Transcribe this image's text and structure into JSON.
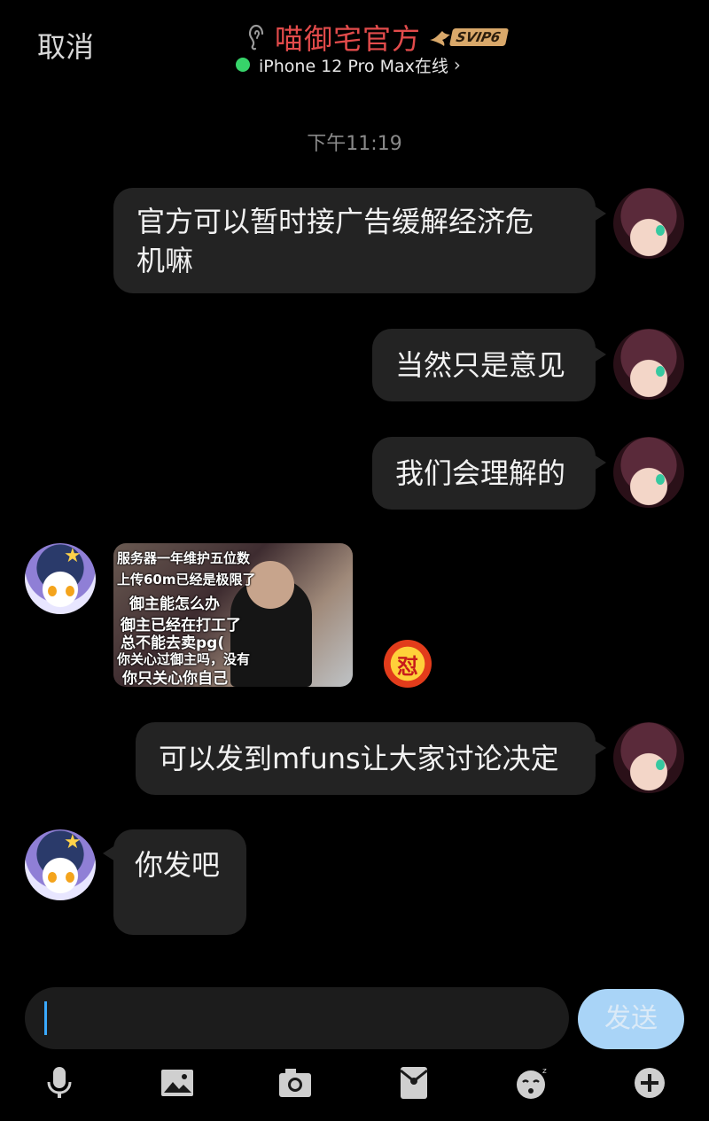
{
  "header": {
    "cancel_label": "取消",
    "title": "喵御宅官方",
    "vip_badge": "SVIP6",
    "status_text": "iPhone 12 Pro Max在线",
    "status_chevron": "›"
  },
  "timestamp": "下午11:19",
  "messages": [
    {
      "side": "right",
      "type": "text",
      "lines": [
        "官方可以暂时接广告缓解经济危",
        "机嘛"
      ]
    },
    {
      "side": "right",
      "type": "text",
      "lines": [
        "当然只是意见"
      ]
    },
    {
      "side": "right",
      "type": "text",
      "lines": [
        "我们会理解的"
      ]
    },
    {
      "side": "left",
      "type": "image",
      "caption_lines": [
        "服务器一年维护五位数",
        "上传60m已经是极限了",
        "御主能怎么办",
        "御主已经在打工了",
        "总不能去卖pg(",
        "你关心过御主吗，没有",
        "你只关心你自己"
      ],
      "sticker_text": "怼"
    },
    {
      "side": "right",
      "type": "text",
      "lines": [
        "可以发到mfuns让大家讨论决定"
      ]
    },
    {
      "side": "left",
      "type": "text",
      "lines": [
        "你发吧"
      ]
    }
  ],
  "input": {
    "value": "",
    "send_label": "发送"
  },
  "toolbar": {
    "icons": [
      "microphone-icon",
      "image-icon",
      "camera-icon",
      "red-packet-icon",
      "emoji-icon",
      "plus-icon"
    ]
  },
  "colors": {
    "title": "#e24b4b",
    "online_dot": "#37d46a",
    "bubble": "#232323",
    "send_button": "#a9d4f7",
    "caret": "#3aa9ff"
  }
}
